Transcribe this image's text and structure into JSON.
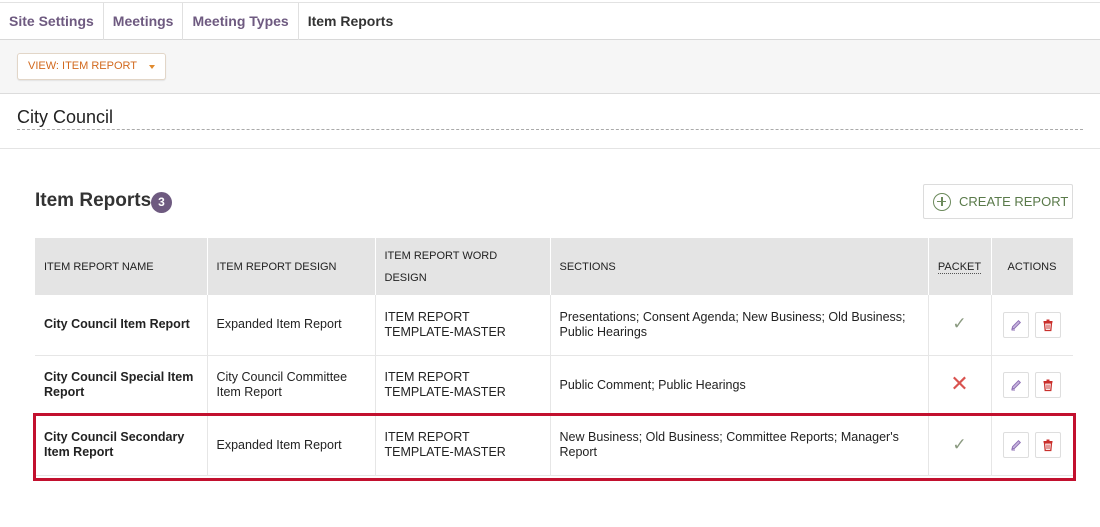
{
  "tabs": [
    {
      "label": "Site Settings"
    },
    {
      "label": "Meetings"
    },
    {
      "label": "Meeting Types"
    },
    {
      "label": "Item Reports",
      "active": true
    }
  ],
  "toolbar": {
    "view_label": "VIEW: ITEM REPORT"
  },
  "council": {
    "title": "City Council"
  },
  "section": {
    "title": "Item Reports",
    "count": "3",
    "create_label": "CREATE REPORT"
  },
  "table": {
    "headers": {
      "name": "ITEM REPORT NAME",
      "design": "ITEM REPORT DESIGN",
      "word_design": "ITEM REPORT WORD DESIGN",
      "sections": "SECTIONS",
      "packet": "PACKET",
      "actions": "ACTIONS"
    },
    "rows": [
      {
        "name": "City Council Item Report",
        "design": "Expanded Item Report",
        "word_design": "ITEM REPORT TEMPLATE-MASTER",
        "sections": "Presentations; Consent Agenda; New Business; Old Business; Public Hearings",
        "packet": "yes",
        "packet_symbol": "✓"
      },
      {
        "name": "City Council Special Item Report",
        "design": "City Council Committee Item Report",
        "word_design": "ITEM REPORT TEMPLATE-MASTER",
        "sections": "Public Comment; Public Hearings",
        "packet": "no",
        "packet_symbol": "✕"
      },
      {
        "name": "City Council Secondary Item Report",
        "design": "Expanded Item Report",
        "word_design": "ITEM REPORT TEMPLATE-MASTER",
        "sections": "New Business; Old Business; Committee Reports; Manager's Report",
        "packet": "yes",
        "packet_symbol": "✓"
      }
    ]
  },
  "colors": {
    "accent_purple": "#6e5a80",
    "view_orange": "#d2691e",
    "delete_red": "#c9302c",
    "highlight_red": "#c2102e",
    "check_green": "#8a9a80"
  },
  "icons": {
    "dropdown": "caret-down-icon",
    "create": "plus-circle-icon",
    "packet_yes": "check-icon",
    "packet_no": "x-icon",
    "edit": "pencil-icon",
    "delete": "trash-icon"
  }
}
